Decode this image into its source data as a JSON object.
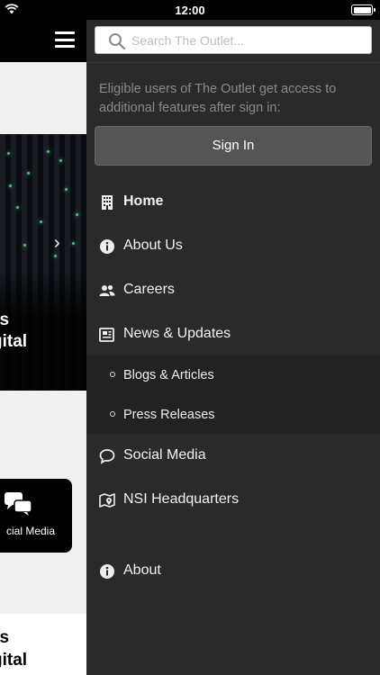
{
  "status_bar": {
    "time": "12:00"
  },
  "background_app": {
    "hero_text_line1": "gies",
    "hero_text_line2": "Digital",
    "card_label": "cial Media",
    "bottom_text_line1": "gies",
    "bottom_text_line2": "Digital"
  },
  "drawer": {
    "search": {
      "placeholder": "Search The Outlet..."
    },
    "info_text": "Eligible users of The Outlet get access to additional features after sign in:",
    "sign_in_label": "Sign In",
    "items": [
      {
        "label": "Home",
        "icon": "building-icon",
        "active": true
      },
      {
        "label": "About Us",
        "icon": "info-circle-icon"
      },
      {
        "label": "Careers",
        "icon": "users-icon"
      },
      {
        "label": "News & Updates",
        "icon": "newspaper-icon"
      },
      {
        "label": "Social Media",
        "icon": "chat-bubble-icon"
      },
      {
        "label": "NSI Headquarters",
        "icon": "map-marker-icon"
      },
      {
        "label": "About",
        "icon": "info-circle-icon"
      }
    ],
    "sub_items": [
      {
        "label": "Blogs & Articles"
      },
      {
        "label": "Press Releases"
      }
    ]
  },
  "colors": {
    "drawer_bg": "#2a2a2a",
    "sub_group_bg": "#222222",
    "sign_in_bg": "#555555"
  }
}
